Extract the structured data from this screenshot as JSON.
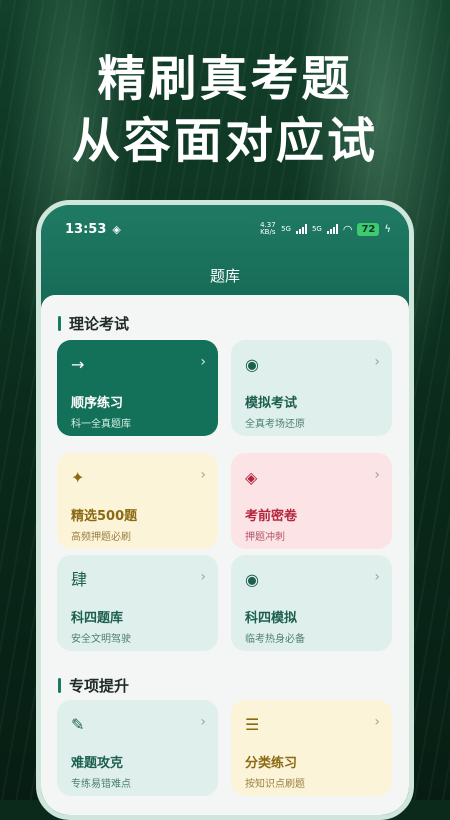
{
  "headline": {
    "line1": "精刷真考题",
    "line2": "从容面对应试"
  },
  "status_bar": {
    "time": "13:53",
    "speed": "4.37 KB/s",
    "network_1": "5G",
    "network_2": "5G",
    "battery": "72"
  },
  "app": {
    "title": "题库"
  },
  "sections": [
    {
      "title": "理论考试",
      "cards": [
        {
          "icon": "→",
          "icon_name": "arrow-right-icon",
          "title": "顺序练习",
          "subtitle": "科一全真题库",
          "style": "green"
        },
        {
          "icon": "◉",
          "icon_name": "target-icon",
          "title": "模拟考试",
          "subtitle": "全真考场还原",
          "style": "mint"
        },
        {
          "icon": "✦",
          "icon_name": "sparkle-icon",
          "title": "精选500题",
          "subtitle": "高频押题必刷",
          "style": "yellow"
        },
        {
          "icon": "◈",
          "icon_name": "diamond-icon",
          "title": "考前密卷",
          "subtitle": "押题冲刺",
          "style": "pink"
        },
        {
          "icon": "肆",
          "icon_name": "four-character-icon",
          "title": "科四题库",
          "subtitle": "安全文明驾驶",
          "style": "mint"
        },
        {
          "icon": "◉",
          "icon_name": "target-icon",
          "title": "科四模拟",
          "subtitle": "临考热身必备",
          "style": "mint"
        }
      ]
    },
    {
      "title": "专项提升",
      "cards": [
        {
          "icon": "✎",
          "icon_name": "pencil-icon",
          "title": "难题攻克",
          "subtitle": "专练易错难点",
          "style": "mint"
        },
        {
          "icon": "☰",
          "icon_name": "list-icon",
          "title": "分类练习",
          "subtitle": "按知识点刷题",
          "style": "yellow"
        }
      ]
    }
  ],
  "chevron": "›",
  "colors": {
    "primary_green": "#137059",
    "mint": "#dff0ec",
    "yellow": "#fcf4d9",
    "pink": "#fbe3e6"
  }
}
